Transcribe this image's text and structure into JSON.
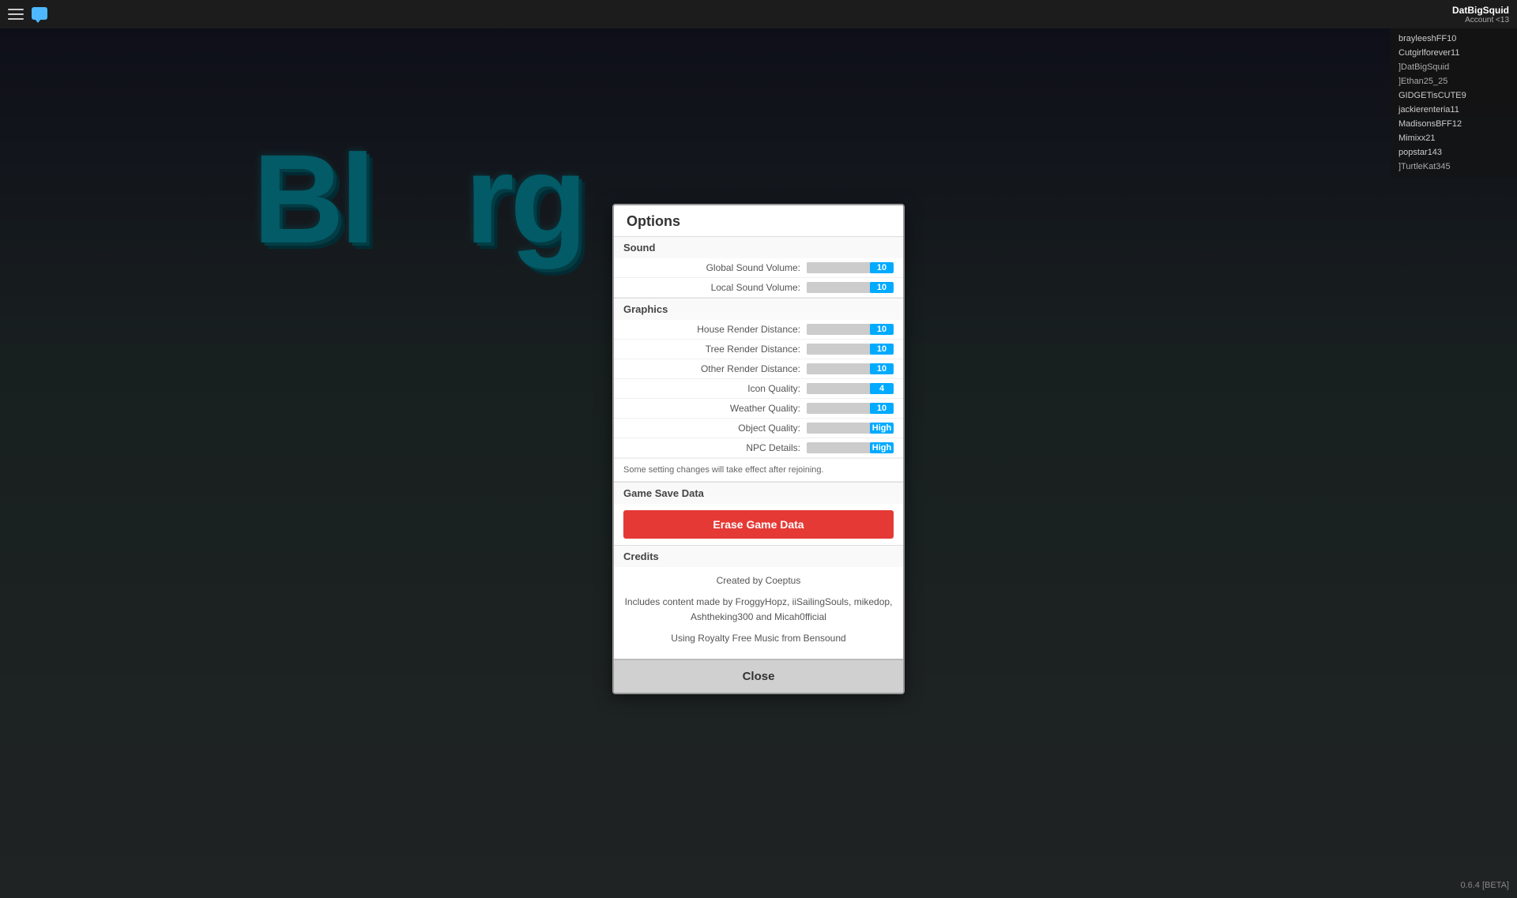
{
  "topbar": {
    "account_name": "DatBigSquid",
    "account_sub": "Account <13"
  },
  "players": [
    {
      "name": "brayleeshFF10",
      "bracket": false
    },
    {
      "name": "Cutgirlforever11",
      "bracket": false
    },
    {
      "name": "]DatBigSquid",
      "bracket": true
    },
    {
      "name": "]Ethan25_25",
      "bracket": true
    },
    {
      "name": "GIDGETisCUTE9",
      "bracket": false
    },
    {
      "name": "jackierenteria11",
      "bracket": false
    },
    {
      "name": "MadisonsBFF12",
      "bracket": false
    },
    {
      "name": "Mimixx21",
      "bracket": false
    },
    {
      "name": "popstar143",
      "bracket": false
    },
    {
      "name": "]TurtleKat345",
      "bracket": true
    }
  ],
  "version": "0.6.4 [BETA]",
  "modal": {
    "title": "Options",
    "sections": {
      "sound": {
        "header": "Sound",
        "settings": [
          {
            "label": "Global Sound Volume:",
            "value": "10",
            "type": "slider"
          },
          {
            "label": "Local Sound Volume:",
            "value": "10",
            "type": "slider"
          }
        ]
      },
      "graphics": {
        "header": "Graphics",
        "settings": [
          {
            "label": "House Render Distance:",
            "value": "10",
            "type": "slider"
          },
          {
            "label": "Tree Render Distance:",
            "value": "10",
            "type": "slider"
          },
          {
            "label": "Other Render Distance:",
            "value": "10",
            "type": "slider"
          },
          {
            "label": "Icon Quality:",
            "value": "4",
            "type": "slider"
          },
          {
            "label": "Weather Quality:",
            "value": "10",
            "type": "slider"
          },
          {
            "label": "Object Quality:",
            "value": "High",
            "type": "text"
          },
          {
            "label": "NPC Details:",
            "value": "High",
            "type": "text"
          }
        ]
      },
      "notice": "Some setting changes will take effect after rejoining.",
      "game_save": {
        "header": "Game Save Data",
        "button_label": "Erase Game Data"
      },
      "credits": {
        "header": "Credits",
        "lines": [
          "Created by Coeptus",
          "Includes content made by FroggyHopz, iiSailingSouls, mikedop, Ashtheking300 and Micah0fficial",
          "Using Royalty Free Music from Bensound"
        ]
      }
    },
    "close_button": "Close"
  }
}
